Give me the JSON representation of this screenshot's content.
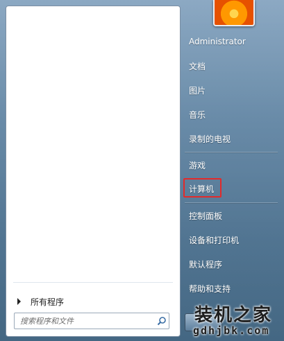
{
  "start_menu": {
    "user": {
      "avatar_icon": "flower-avatar-icon"
    },
    "left_pane": {
      "programs": [],
      "all_programs_label": "所有程序"
    },
    "search": {
      "placeholder": "搜索程序和文件"
    },
    "right_pane": {
      "items": [
        {
          "label": "Administrator"
        },
        {
          "label": "文档"
        },
        {
          "label": "图片"
        },
        {
          "label": "音乐"
        },
        {
          "label": "录制的电视"
        },
        {
          "label": "游戏"
        },
        {
          "label": "计算机",
          "highlighted": true
        },
        {
          "label": "控制面板"
        },
        {
          "label": "设备和打印机"
        },
        {
          "label": "默认程序"
        },
        {
          "label": "帮助和支持"
        }
      ]
    },
    "watermark": {
      "chinese": "装机之家",
      "url": "gdhjbk.com"
    },
    "colors": {
      "highlight": "#e32a2a",
      "pane_bg": "#ffffff",
      "right_text": "#ffffff"
    }
  }
}
